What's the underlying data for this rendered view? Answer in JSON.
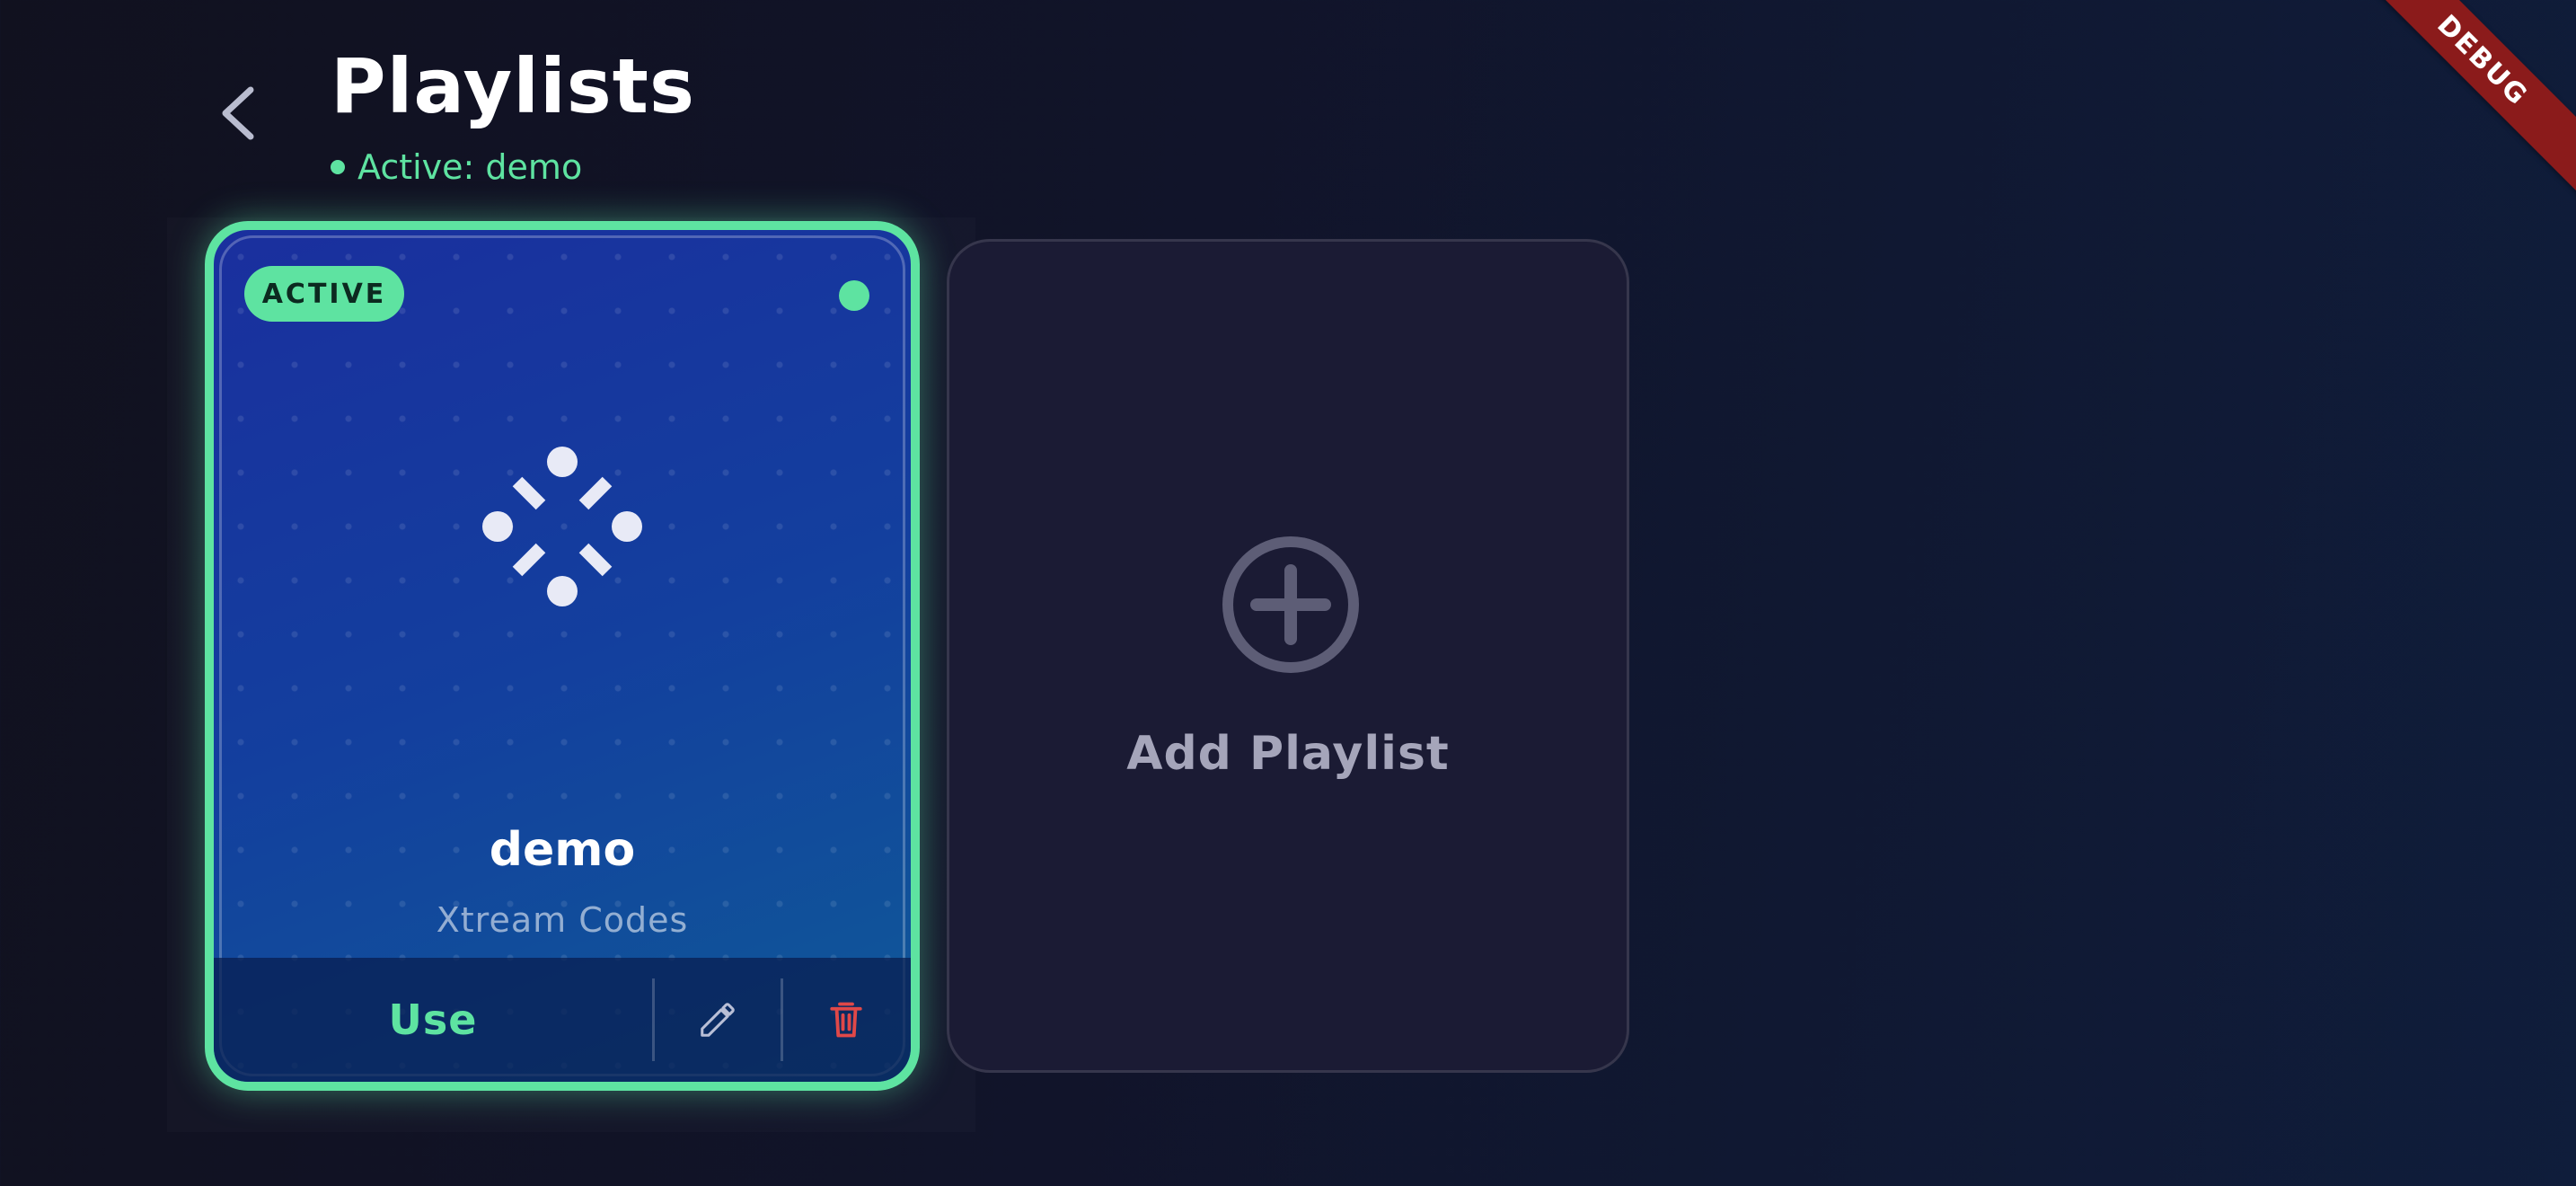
{
  "header": {
    "title": "Playlists",
    "active_status": "Active: demo"
  },
  "playlists": [
    {
      "badge": "ACTIVE",
      "name": "demo",
      "type": "Xtream Codes",
      "use_label": "Use",
      "edit_icon": "pencil-icon",
      "delete_icon": "trash-icon"
    }
  ],
  "add_card": {
    "label": "Add Playlist",
    "icon": "plus-circle-icon"
  },
  "debug_banner": "DEBUG",
  "colors": {
    "accent": "#5ee3a1",
    "danger": "#e04848",
    "card_gradient_start": "#1a2f9e",
    "card_gradient_end": "#0f5a98",
    "add_card_bg": "#1b1b34"
  }
}
